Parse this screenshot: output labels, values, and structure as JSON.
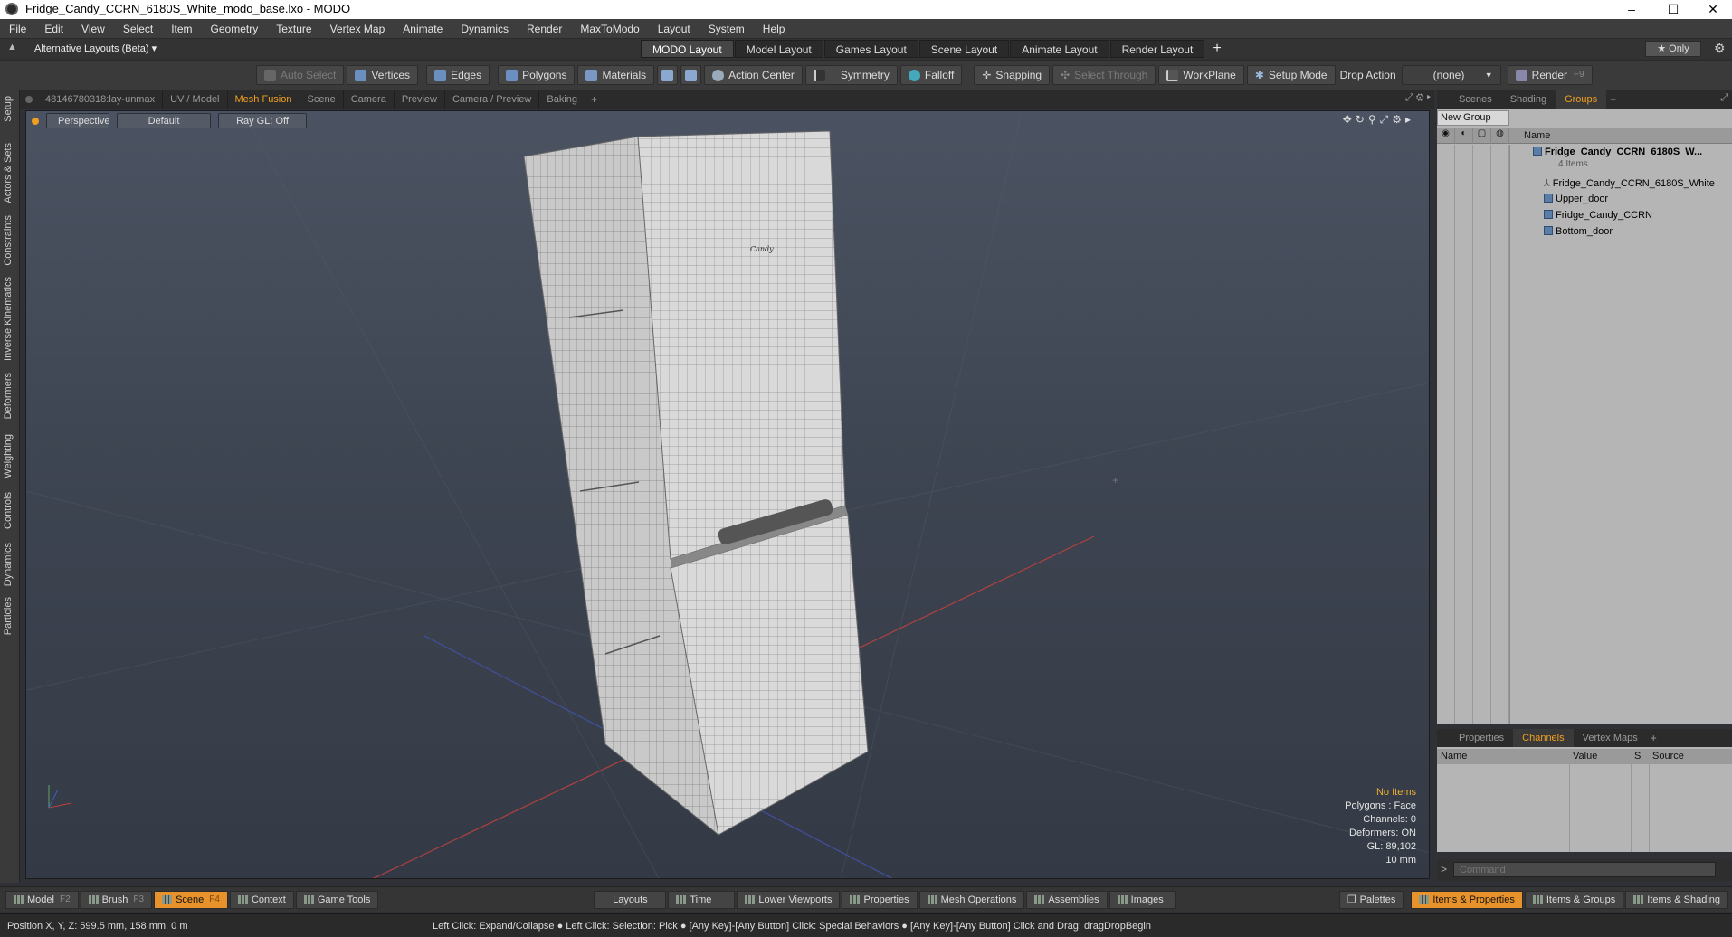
{
  "window": {
    "title": "Fridge_Candy_CCRN_6180S_White_modo_base.lxo - MODO",
    "minimize": "–",
    "maximize": "☐",
    "close": "✕"
  },
  "menu": [
    "File",
    "Edit",
    "View",
    "Select",
    "Item",
    "Geometry",
    "Texture",
    "Vertex Map",
    "Animate",
    "Dynamics",
    "Render",
    "MaxToModo",
    "Layout",
    "System",
    "Help"
  ],
  "layouts": {
    "switcher": "Alternative Layouts (Beta) ▾",
    "tabs": [
      "MODO Layout",
      "Model Layout",
      "Games Layout",
      "Scene Layout",
      "Animate Layout",
      "Render Layout"
    ],
    "active": "MODO Layout",
    "add": "+",
    "only": "★  Only"
  },
  "toolbar": {
    "auto_select": "Auto Select",
    "vertices": "Vertices",
    "edges": "Edges",
    "polygons": "Polygons",
    "materials": "Materials",
    "action_center": "Action Center",
    "symmetry": "Symmetry",
    "falloff": "Falloff",
    "snapping": "Snapping",
    "select_through": "Select Through",
    "workplane": "WorkPlane",
    "setup_mode": "Setup Mode",
    "drop_action": "Drop Action",
    "drop_value": "(none)",
    "render": "Render",
    "render_key": "F9"
  },
  "left_tabs": [
    "Setup",
    "Actors & Sets",
    "Constraints",
    "Inverse Kinematics",
    "Deformers",
    "Weighting",
    "Controls",
    "Dynamics",
    "Particles"
  ],
  "viewport_tabs": [
    "481467803​18:lay-unmax",
    "UV / Model",
    "Mesh Fusion",
    "Scene",
    "Camera",
    "Preview",
    "Camera / Preview",
    "Baking"
  ],
  "viewport_active_tab": "Mesh Fusion",
  "viewport": {
    "perspective": "Perspective",
    "shading": "Default",
    "raygl": "Ray GL: Off",
    "brand": "Candy",
    "stats": {
      "items": "No Items",
      "polygons": "Polygons : Face",
      "channels": "Channels: 0",
      "deformers": "Deformers: ON",
      "gl": "GL: 89,102",
      "scale": "10 mm"
    }
  },
  "right_tabs": [
    "Scenes",
    "Shading",
    "Groups"
  ],
  "right_active": "Groups",
  "groups": {
    "new_group": "New Group",
    "name_header": "Name",
    "root": "Fridge_Candy_CCRN_6180S_W...",
    "count": "4 Items",
    "children": [
      "Fridge_Candy_CCRN_6180S_White",
      "Upper_door",
      "Fridge_Candy_CCRN",
      "Bottom_door"
    ]
  },
  "prop_tabs": [
    "Properties",
    "Channels",
    "Vertex Maps"
  ],
  "prop_active": "Channels",
  "channels_cols": [
    "Name",
    "Value",
    "S",
    "Source"
  ],
  "command_placeholder": "Command",
  "bottom": {
    "model": "Model",
    "model_key": "F2",
    "brush": "Brush",
    "brush_key": "F3",
    "scene": "Scene",
    "scene_key": "F4",
    "context": "Context",
    "game_tools": "Game Tools",
    "layouts": "Layouts",
    "time": "Time",
    "lower_viewports": "Lower Viewports",
    "properties": "Properties",
    "mesh_operations": "Mesh Operations",
    "assemblies": "Assemblies",
    "images": "Images",
    "palettes": "Palettes",
    "items_properties": "Items & Properties",
    "items_groups": "Items & Groups",
    "items_shading": "Items & Shading"
  },
  "status": {
    "position": "Position X, Y, Z:   599.5 mm, 158 mm, 0 m",
    "hint": "Left Click: Expand/Collapse ● Left Click: Selection: Pick ● [Any Key]-[Any Button] Click: Special Behaviors ● [Any Key]-[Any Button] Click and Drag: dragDropBegin"
  }
}
